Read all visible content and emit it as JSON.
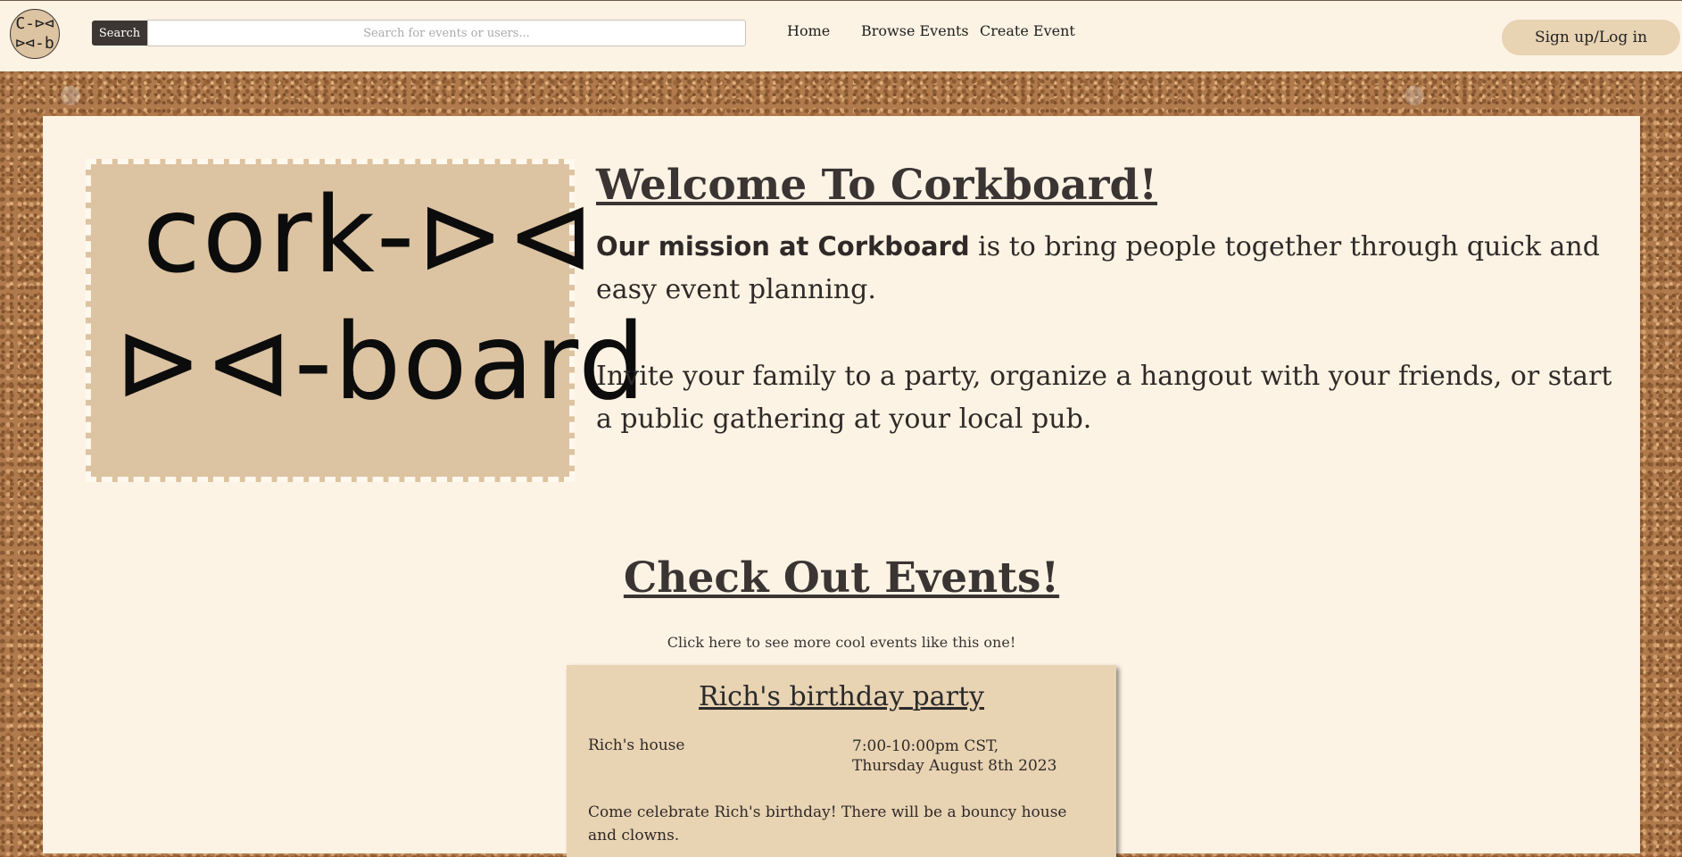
{
  "navbar": {
    "logo_top": "C-⊳⊲",
    "logo_bottom": "⊳⊲-b",
    "search_button": "Search",
    "search_placeholder": "Search for events or users...",
    "links": [
      "Home",
      "Browse Events",
      "Create Event"
    ],
    "login_label": "Sign up/Log in"
  },
  "hero": {
    "logo_line1": "cork-⊳⊲",
    "logo_line2": "⊳⊲-board",
    "title": "Welcome To Corkboard!",
    "mission_bold": "Our mission at Corkboard",
    "mission_rest": " is to bring people together through quick and easy event planning.",
    "invite": "Invite your family to a party, organize a hangout with your friends, or start a public gathering at your local pub."
  },
  "events_section": {
    "title": "Check Out Events!",
    "subtitle": "Click here to see more cool events like this one!",
    "featured": {
      "title": "Rich's birthday party",
      "location": "Rich's house",
      "time": "7:00-10:00pm CST, Thursday August 8th 2023",
      "description": "Come celebrate Rich's birthday! There will be a bouncy house and clowns."
    }
  },
  "colors": {
    "background_cork": "#b07a4c",
    "panel": "#fdf3e4",
    "accent_tan": "#e8d3b3",
    "dark_button": "#3c3634"
  }
}
